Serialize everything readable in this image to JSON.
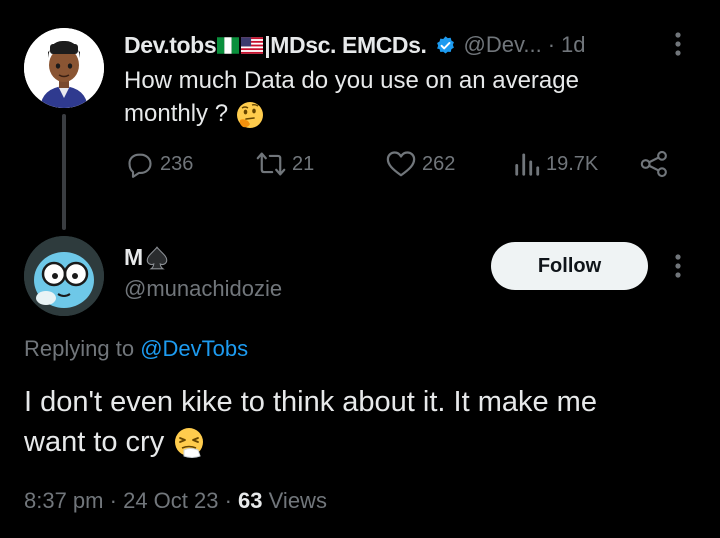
{
  "parent_tweet": {
    "display_name_a": "Dev.tobs",
    "display_name_b": "|MDsc. EMCDs.",
    "handle": "@Dev...",
    "separator": "·",
    "time": "1d",
    "text_line1": "How much Data do you use  on an average",
    "text_line2": "monthly ?",
    "emoji_icon": "thinking-face-icon",
    "replies": "236",
    "reposts": "21",
    "likes": "262",
    "views": "19.7K"
  },
  "reply_tweet": {
    "display_name": "M",
    "name_icon": "spade-icon",
    "handle": "@munachidozie",
    "follow_label": "Follow",
    "replying_prefix": "Replying to",
    "replying_mention": "@DevTobs",
    "text_line1": "I don't even kike to think about it. It make me",
    "text_line2": "want to cry",
    "emoji_icon": "sneezing-face-icon",
    "time": "8:37 pm",
    "date": "24 Oct 23",
    "sep": "·",
    "views_count": "63",
    "views_label": "Views"
  },
  "colors": {
    "background": "#000000",
    "text": "#e7e9ea",
    "muted": "#71767b",
    "link": "#1d9bf0",
    "verified": "#1d9bf0",
    "button_bg": "#eff3f4"
  }
}
